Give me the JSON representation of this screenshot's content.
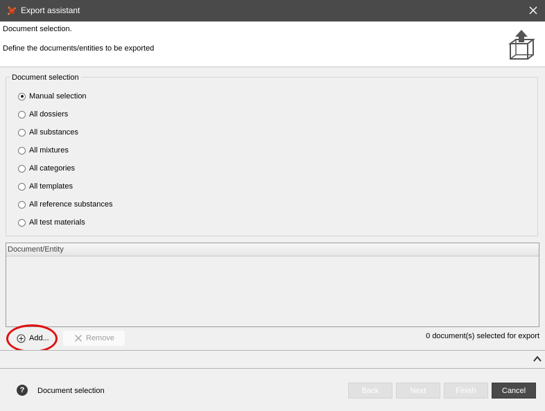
{
  "window": {
    "title": "Export assistant"
  },
  "header": {
    "title": "Document selection.",
    "description": "Define the documents/entities to be exported"
  },
  "document_selection": {
    "legend": "Document selection",
    "options": [
      {
        "label": "Manual selection",
        "checked": true
      },
      {
        "label": "All dossiers",
        "checked": false
      },
      {
        "label": "All substances",
        "checked": false
      },
      {
        "label": "All mixtures",
        "checked": false
      },
      {
        "label": "All categories",
        "checked": false
      },
      {
        "label": "All templates",
        "checked": false
      },
      {
        "label": "All reference substances",
        "checked": false
      },
      {
        "label": "All test materials",
        "checked": false
      }
    ]
  },
  "table": {
    "column_header": "Document/Entity",
    "rows": []
  },
  "actions": {
    "add_label": "Add...",
    "remove_label": "Remove"
  },
  "status": {
    "selected_count": "0 document(s) selected for export"
  },
  "footer": {
    "help_text": "Document selection",
    "back_label": "Back",
    "next_label": "Next",
    "finish_label": "Finish",
    "cancel_label": "Cancel"
  },
  "colors": {
    "titlebar": "#4a4a4a",
    "highlight": "#e01010",
    "primary_button": "#4a4a4a"
  }
}
